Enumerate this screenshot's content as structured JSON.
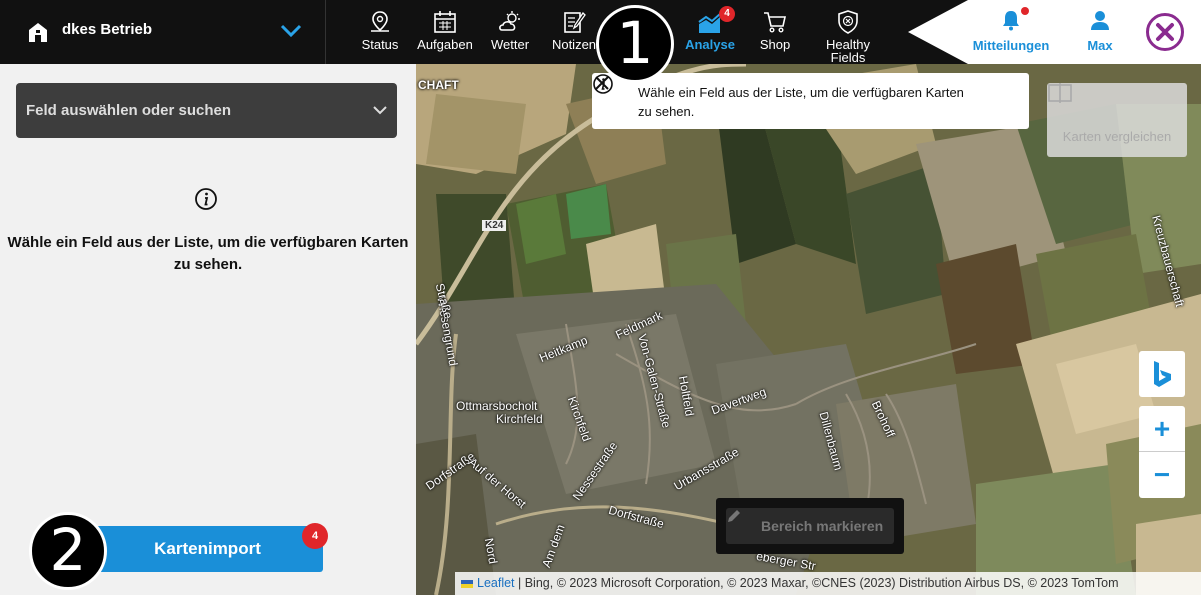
{
  "header": {
    "farm_name": "dkes Betrieb",
    "nav": [
      {
        "label": "Status",
        "icon": "map-pin-icon"
      },
      {
        "label": "Aufgaben",
        "icon": "calendar-icon"
      },
      {
        "label": "Wetter",
        "icon": "weather-icon"
      },
      {
        "label": "Notizen",
        "icon": "notes-icon"
      },
      {
        "label": "Analyse",
        "icon": "analysis-icon",
        "badge": "4",
        "active": true
      },
      {
        "label": "Shop",
        "icon": "cart-icon"
      },
      {
        "label": "Healthy\nFields",
        "icon": "shield-icon"
      }
    ],
    "notifications_label": "Mitteilungen",
    "user_label": "Max",
    "accent_color": "#1a8fd8",
    "badge_color": "#e0262a"
  },
  "sidebar": {
    "field_select_placeholder": "Feld auswählen oder suchen",
    "info_message": "Wähle ein Feld aus der Liste, um die verfügbaren Karten zu sehen.",
    "import_button": "Kartenimport",
    "import_badge": "4"
  },
  "markers": {
    "one": "1",
    "two": "2"
  },
  "map": {
    "toast_message": "Wähle ein Feld aus der Liste, um die verfügbaren Karten zu sehen.",
    "compare_button": "Karten vergleichen",
    "zoom_in": "+",
    "zoom_out": "−",
    "area_button": "Bereich markieren",
    "attribution_link": "Leaflet",
    "attribution_text": " | Bing, © 2023 Microsoft Corporation, © 2023 Maxar, ©CNES (2023) Distribution Airbus DS, © 2023 TomTom",
    "labels": {
      "top_left": "CHAFT",
      "k24": "K24",
      "feldmark": "Feldmark",
      "heitkamp": "Heitkamp",
      "von_galen": "Von-Galen-Straße",
      "holtfeld": "Holtfeld",
      "davertweg": "Davertweg",
      "ottmarsbocholt": "Ottmarsbocholt",
      "kirchfeld_place": "Kirchfeld",
      "kirchfeld_street": "Kirchfeld",
      "nessestrasse": "Nessestraße",
      "urbansstrasse": "Urbansstraße",
      "dillenbaum": "Dillenbaum",
      "brohoff": "Brohoff",
      "dorfstrasse_left": "Dorfstraße",
      "dorfstrasse_bottom": "Dorfstraße",
      "auf_der_horst": "Auf der Horst",
      "wiesengrund": "Wiesengrund",
      "strasse_left": "Straße",
      "kreuzbauerschaft": "Kreuzbauerschaft",
      "nord": "Nord",
      "am_dem": "Am dem",
      "weberger": "eberger Str"
    }
  }
}
